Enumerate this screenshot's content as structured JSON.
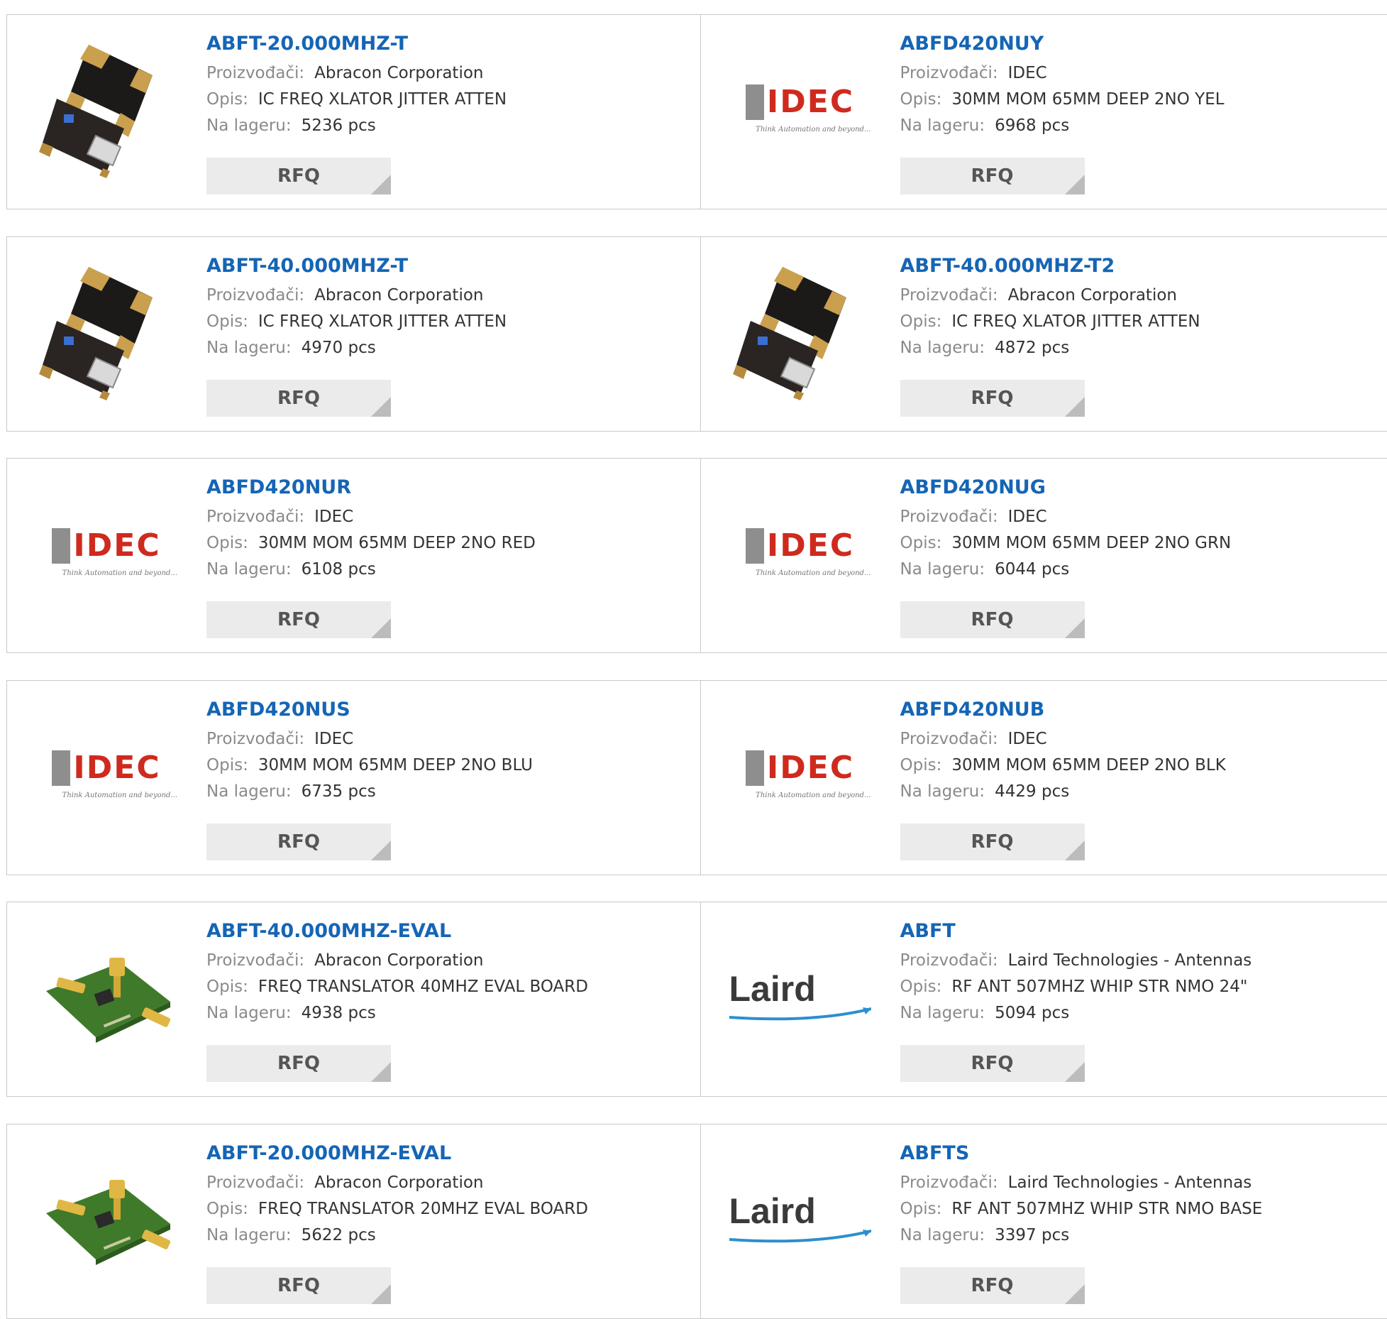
{
  "colors": {
    "link": "#1565b5",
    "label": "#8a8a8a",
    "value": "#333333",
    "button_bg": "#ebebeb",
    "border": "#c9c9c9"
  },
  "labels": {
    "manufacturer": "Proizvođači:",
    "description": "Opis:",
    "stock": "Na lageru:",
    "rfq": "RFQ"
  },
  "rows": [
    [
      {
        "part": "ABFT-20.000MHZ-T",
        "manufacturer": "Abracon Corporation",
        "description": "IC FREQ XLATOR JITTER ATTEN",
        "stock": "5236 pcs",
        "image": "module"
      },
      {
        "part": "ABFD420NUY",
        "manufacturer": "IDEC",
        "description": "30MM MOM 65MM DEEP 2NO YEL",
        "stock": "6968 pcs",
        "image": "idec"
      }
    ],
    [
      {
        "part": "ABFT-40.000MHZ-T",
        "manufacturer": "Abracon Corporation",
        "description": "IC FREQ XLATOR JITTER ATTEN",
        "stock": "4970 pcs",
        "image": "module"
      },
      {
        "part": "ABFT-40.000MHZ-T2",
        "manufacturer": "Abracon Corporation",
        "description": "IC FREQ XLATOR JITTER ATTEN",
        "stock": "4872 pcs",
        "image": "module"
      }
    ],
    [
      {
        "part": "ABFD420NUR",
        "manufacturer": "IDEC",
        "description": "30MM MOM 65MM DEEP 2NO RED",
        "stock": "6108 pcs",
        "image": "idec"
      },
      {
        "part": "ABFD420NUG",
        "manufacturer": "IDEC",
        "description": "30MM MOM 65MM DEEP 2NO GRN",
        "stock": "6044 pcs",
        "image": "idec"
      }
    ],
    [
      {
        "part": "ABFD420NUS",
        "manufacturer": "IDEC",
        "description": "30MM MOM 65MM DEEP 2NO BLU",
        "stock": "6735 pcs",
        "image": "idec"
      },
      {
        "part": "ABFD420NUB",
        "manufacturer": "IDEC",
        "description": "30MM MOM 65MM DEEP 2NO BLK",
        "stock": "4429 pcs",
        "image": "idec"
      }
    ],
    [
      {
        "part": "ABFT-40.000MHZ-EVAL",
        "manufacturer": "Abracon Corporation",
        "description": "FREQ TRANSLATOR 40MHZ EVAL BOARD",
        "stock": "4938 pcs",
        "image": "evalboard"
      },
      {
        "part": "ABFT",
        "manufacturer": "Laird Technologies - Antennas",
        "description": "RF ANT 507MHZ WHIP STR NMO 24\"",
        "stock": "5094 pcs",
        "image": "laird"
      }
    ],
    [
      {
        "part": "ABFT-20.000MHZ-EVAL",
        "manufacturer": "Abracon Corporation",
        "description": "FREQ TRANSLATOR 20MHZ EVAL BOARD",
        "stock": "5622 pcs",
        "image": "evalboard"
      },
      {
        "part": "ABFTS",
        "manufacturer": "Laird Technologies - Antennas",
        "description": "RF ANT 507MHZ WHIP STR NMO BASE",
        "stock": "3397 pcs",
        "image": "laird"
      }
    ]
  ],
  "logos": {
    "idec": {
      "text": "IDEC",
      "tagline": "Think Automation and beyond..."
    },
    "laird": {
      "text": "Laird"
    }
  }
}
